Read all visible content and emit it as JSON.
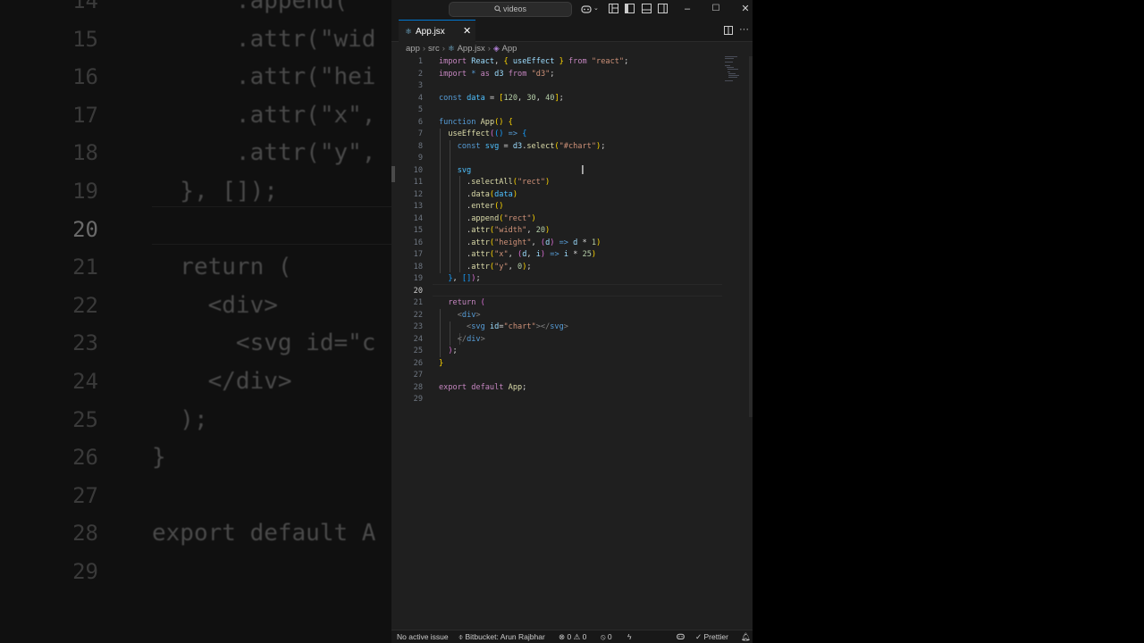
{
  "background": {
    "rows": [
      {
        "num": "14",
        "code": "      .append(\""
      },
      {
        "num": "15",
        "code": "      .attr(\"wid"
      },
      {
        "num": "16",
        "code": "      .attr(\"hei"
      },
      {
        "num": "17",
        "code": "      .attr(\"x\","
      },
      {
        "num": "18",
        "code": "      .attr(\"y\","
      },
      {
        "num": "19",
        "code": "  }, []);"
      },
      {
        "num": "20",
        "code": ""
      },
      {
        "num": "21",
        "code": "  return ("
      },
      {
        "num": "22",
        "code": "    <div>"
      },
      {
        "num": "23",
        "code": "      <svg id=\"c"
      },
      {
        "num": "24",
        "code": "    </div>"
      },
      {
        "num": "25",
        "code": "  );"
      },
      {
        "num": "26",
        "code": "}"
      },
      {
        "num": "27",
        "code": ""
      },
      {
        "num": "28",
        "code": "export default A"
      },
      {
        "num": "29",
        "code": ""
      }
    ]
  },
  "titlebar": {
    "search_text": "videos",
    "icons": [
      "copilot-icon",
      "layout-customize-icon",
      "toggle-sidebar-icon",
      "toggle-panel-icon",
      "toggle-secondary-sidebar-icon"
    ],
    "minimize": "–",
    "maximize": "☐",
    "close": "✕"
  },
  "tabs": {
    "active": {
      "label": "App.jsx",
      "close": "✕",
      "icon": "react-file-icon"
    },
    "split_action": "split-editor-icon",
    "more_action": "···"
  },
  "breadcrumb": {
    "items": [
      "app",
      "src",
      "App.jsx",
      "App"
    ]
  },
  "editor": {
    "current_line": "20",
    "line_numbers": [
      "1",
      "2",
      "3",
      "4",
      "5",
      "6",
      "7",
      "8",
      "9",
      "10",
      "11",
      "12",
      "13",
      "14",
      "15",
      "16",
      "17",
      "18",
      "19",
      "20",
      "21",
      "22",
      "23",
      "24",
      "25",
      "26",
      "27",
      "28",
      "29"
    ]
  },
  "statusbar": {
    "issue": "No active issue",
    "bitbucket": "Bitbucket: Arun Rajbhar",
    "errors": "0",
    "warnings": "0",
    "ports": "0",
    "prettier": "Prettier"
  },
  "colors": {
    "editor_bg": "#1f1f1f",
    "chrome_bg": "#181818",
    "accent": "#0078d4",
    "keyword": "#c586c0",
    "string": "#ce9178",
    "function": "#dcdcaa",
    "variable": "#9cdcfe",
    "number": "#b5cea8"
  }
}
